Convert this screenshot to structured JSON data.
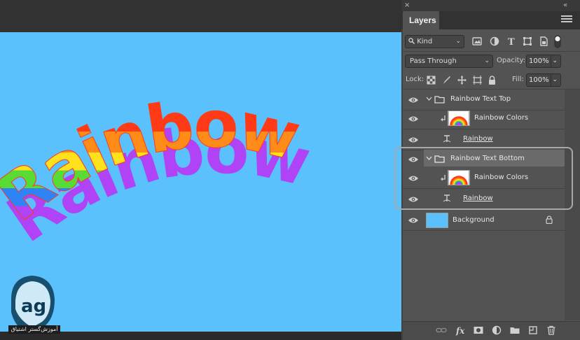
{
  "window": {
    "close_glyph": "×",
    "collapse_glyph": "«"
  },
  "panel": {
    "tab_label": "Layers",
    "filter_kind": "Kind",
    "blend_mode": "Pass Through",
    "opacity_label": "Opacity:",
    "opacity_value": "100%",
    "lock_label": "Lock:",
    "fill_label": "Fill:",
    "fill_value": "100%"
  },
  "layers": [
    {
      "name": "Rainbow Text Top",
      "kind": "group",
      "expanded": true
    },
    {
      "name": "Rainbow Colors",
      "kind": "image",
      "clipped": true
    },
    {
      "name": "Rainbow",
      "kind": "text-warp"
    },
    {
      "name": "Rainbow Text Bottom",
      "kind": "group",
      "expanded": true,
      "selected": true
    },
    {
      "name": "Rainbow Colors",
      "kind": "image",
      "clipped": true
    },
    {
      "name": "Rainbow",
      "kind": "text-warp"
    },
    {
      "name": "Background",
      "kind": "background",
      "locked": true
    }
  ],
  "canvas": {
    "artwork_text": "Rainbow",
    "background_color": "#5bc1fc",
    "rainbow_colors": [
      "#ff3a16",
      "#ff8b18",
      "#ffe11d",
      "#59db35",
      "#2f83f5",
      "#b043f5"
    ]
  },
  "watermark": {
    "logo_text": "ag",
    "caption": "آموزش‌گستر اشتیاق"
  },
  "footer_icons": [
    "link-icon",
    "fx-icon",
    "mask-icon",
    "adjustment-icon",
    "new-group-icon",
    "new-layer-icon",
    "trash-icon"
  ],
  "colors": {
    "panel_bg": "#535353",
    "selected_row": "#6a6a6a",
    "frame": "#323232"
  }
}
